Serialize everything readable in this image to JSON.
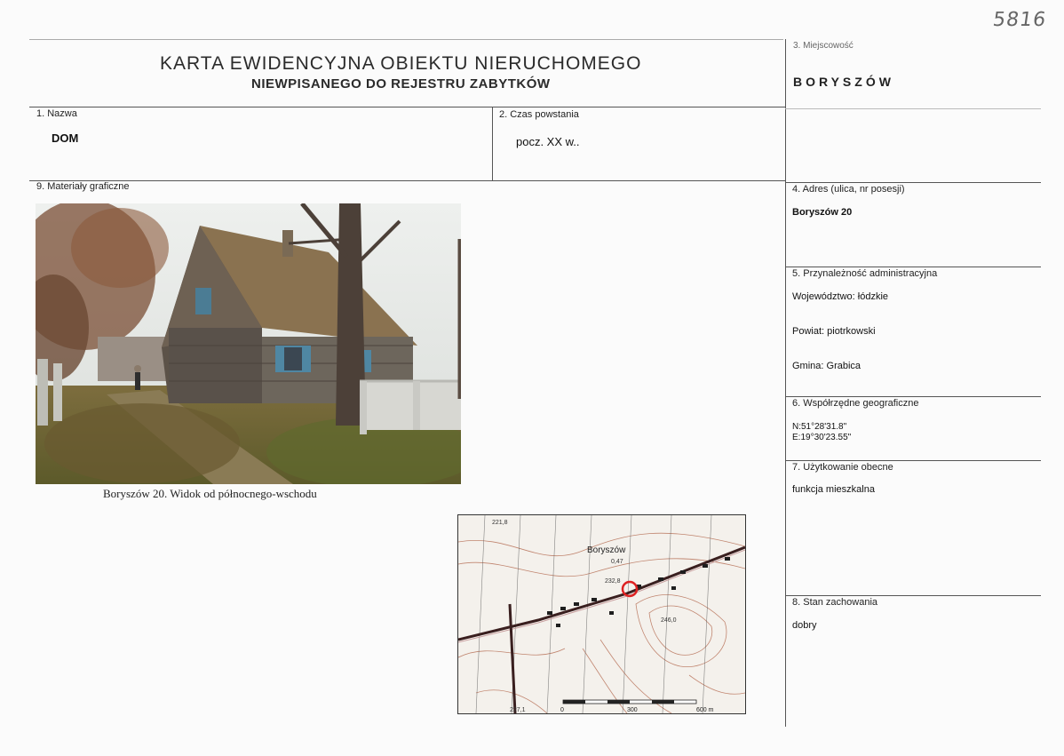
{
  "handwritten_number": "5816",
  "header": {
    "title_line1": "KARTA EWIDENCYJNA OBIEKTU NIERUCHOMEGO",
    "title_line2": "NIEWPISANEGO DO REJESTRU ZABYTKÓW"
  },
  "fields": {
    "nazwa": {
      "label": "1. Nazwa",
      "value": "DOM"
    },
    "czas": {
      "label": "2. Czas powstania",
      "value": "pocz. XX w.."
    },
    "miejscowosc": {
      "label": "3. Miejscowość",
      "value": "BORYSZÓW"
    },
    "adres": {
      "label": "4. Adres (ulica, nr posesji)",
      "value": "Boryszów 20"
    },
    "przynaleznosc": {
      "label": "5. Przynależność administracyjna",
      "wojewodztwo": "Województwo: łódzkie",
      "powiat": "Powiat: piotrkowski",
      "gmina": "Gmina: Grabica"
    },
    "wspolrzedne": {
      "label": "6. Współrzędne geograficzne",
      "n": "N:51°28'31.8\"",
      "e": "E:19°30'23.55\""
    },
    "uzytkowanie": {
      "label": "7. Użytkowanie obecne",
      "value": "funkcja mieszkalna"
    },
    "stan": {
      "label": "8. Stan zachowania",
      "value": "dobry"
    },
    "materialy": {
      "label": "9. Materiały graficzne",
      "photo_caption": "Boryszów 20. Widok od północnego-wschodu"
    }
  },
  "map": {
    "place_label": "Boryszów",
    "place_number": "0,47",
    "elevations": [
      "221,8",
      "232,8",
      "246,0",
      "227,1"
    ],
    "scale_labels": [
      "0",
      "300",
      "600 m"
    ]
  }
}
